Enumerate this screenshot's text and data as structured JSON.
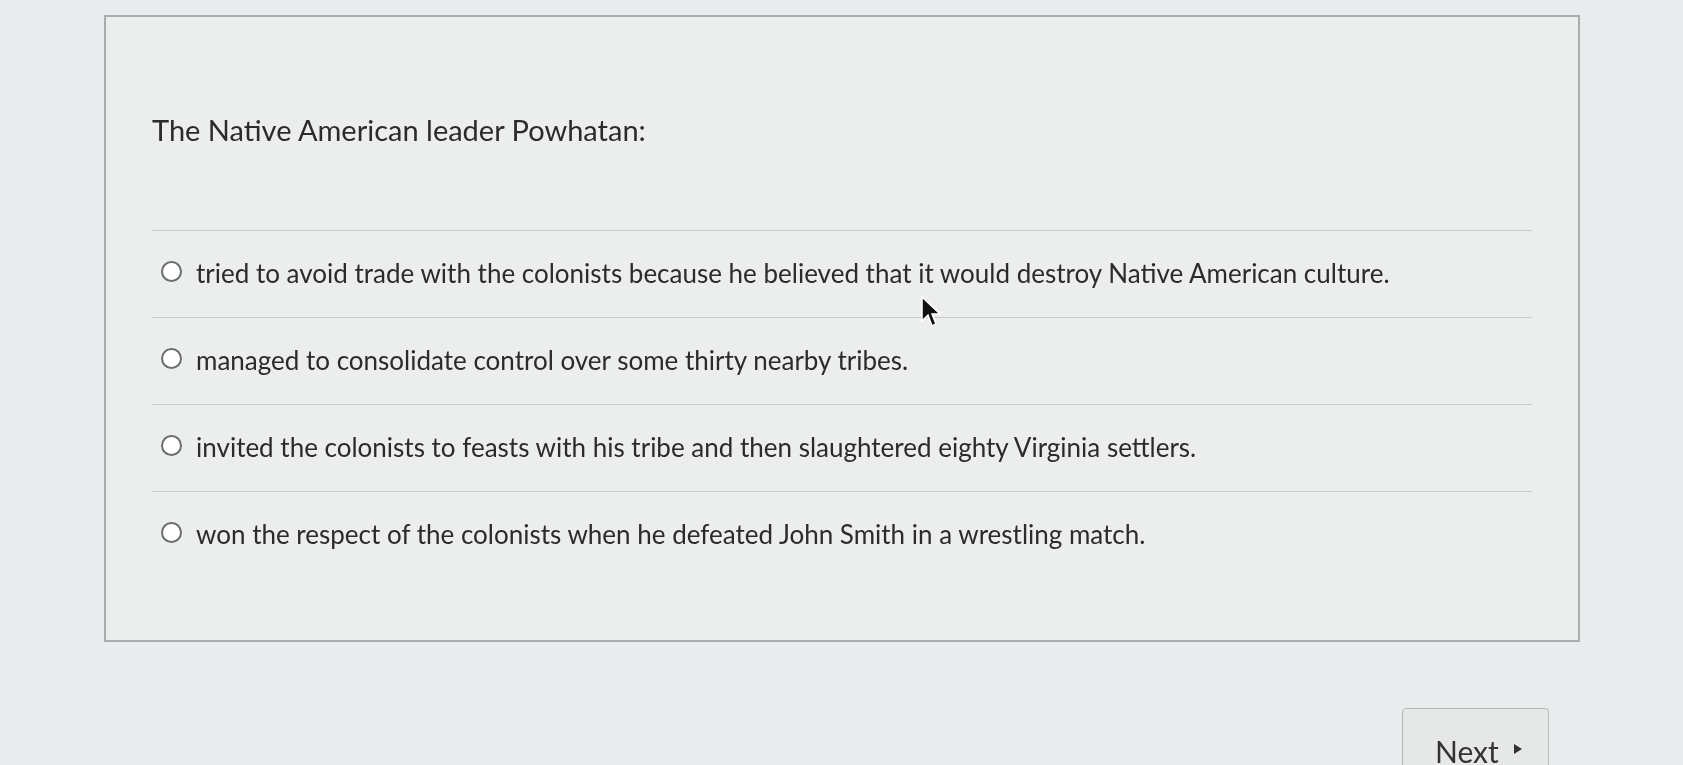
{
  "question": "The Native American leader Powhatan:",
  "options": [
    {
      "text": "tried to avoid trade with the colonists because he believed that it would destroy Native American culture.",
      "selected": false
    },
    {
      "text": "managed to consolidate control over some thirty nearby tribes.",
      "selected": false
    },
    {
      "text": "invited the colonists to feasts with his tribe and then slaughtered eighty Virginia settlers.",
      "selected": false
    },
    {
      "text": "won the respect of the colonists when he defeated John Smith in a wrestling match.",
      "selected": false
    }
  ],
  "next_button": {
    "label": "Next"
  }
}
